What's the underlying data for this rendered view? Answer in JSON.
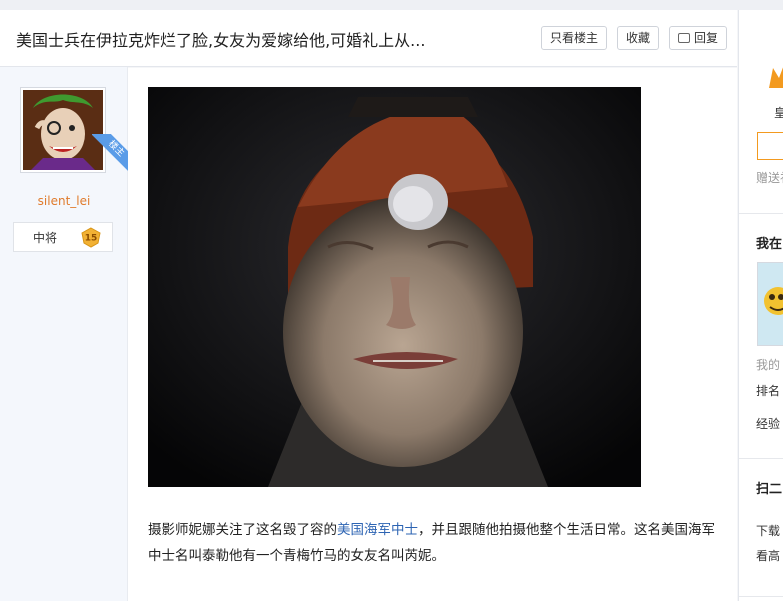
{
  "header": {
    "title": "美国士兵在伊拉克炸烂了脸,女友为爱嫁给他,可婚礼上从...",
    "only_op_label": "只看楼主",
    "favorite_label": "收藏",
    "reply_label": "回复"
  },
  "author": {
    "op_tag": "楼主",
    "username": "silent_lei",
    "rank_name": "中将",
    "rank_level": "15"
  },
  "post": {
    "text_before_link": "摄影师妮娜关注了这名毁了容的",
    "link_text": "美国海军中士",
    "text_after_link": "，并且跟随他拍摄他整个生活日常。这名美国海军中士名叫泰勒他有一个青梅竹马的女友名叫芮妮。"
  },
  "sidebar": {
    "gift_text": "皇",
    "gift_hint": "赠送礼",
    "section1_title": "我在",
    "stat_my": "我的",
    "stat_rank": "排名",
    "stat_exp": "经验",
    "section2_title": "扫二",
    "download_text": "下载",
    "watch_text": "看高"
  },
  "colors": {
    "username": "#e07b2c",
    "link": "#2d64b3",
    "op_tag": "#5a9ce8",
    "badge": "#f2b134"
  }
}
